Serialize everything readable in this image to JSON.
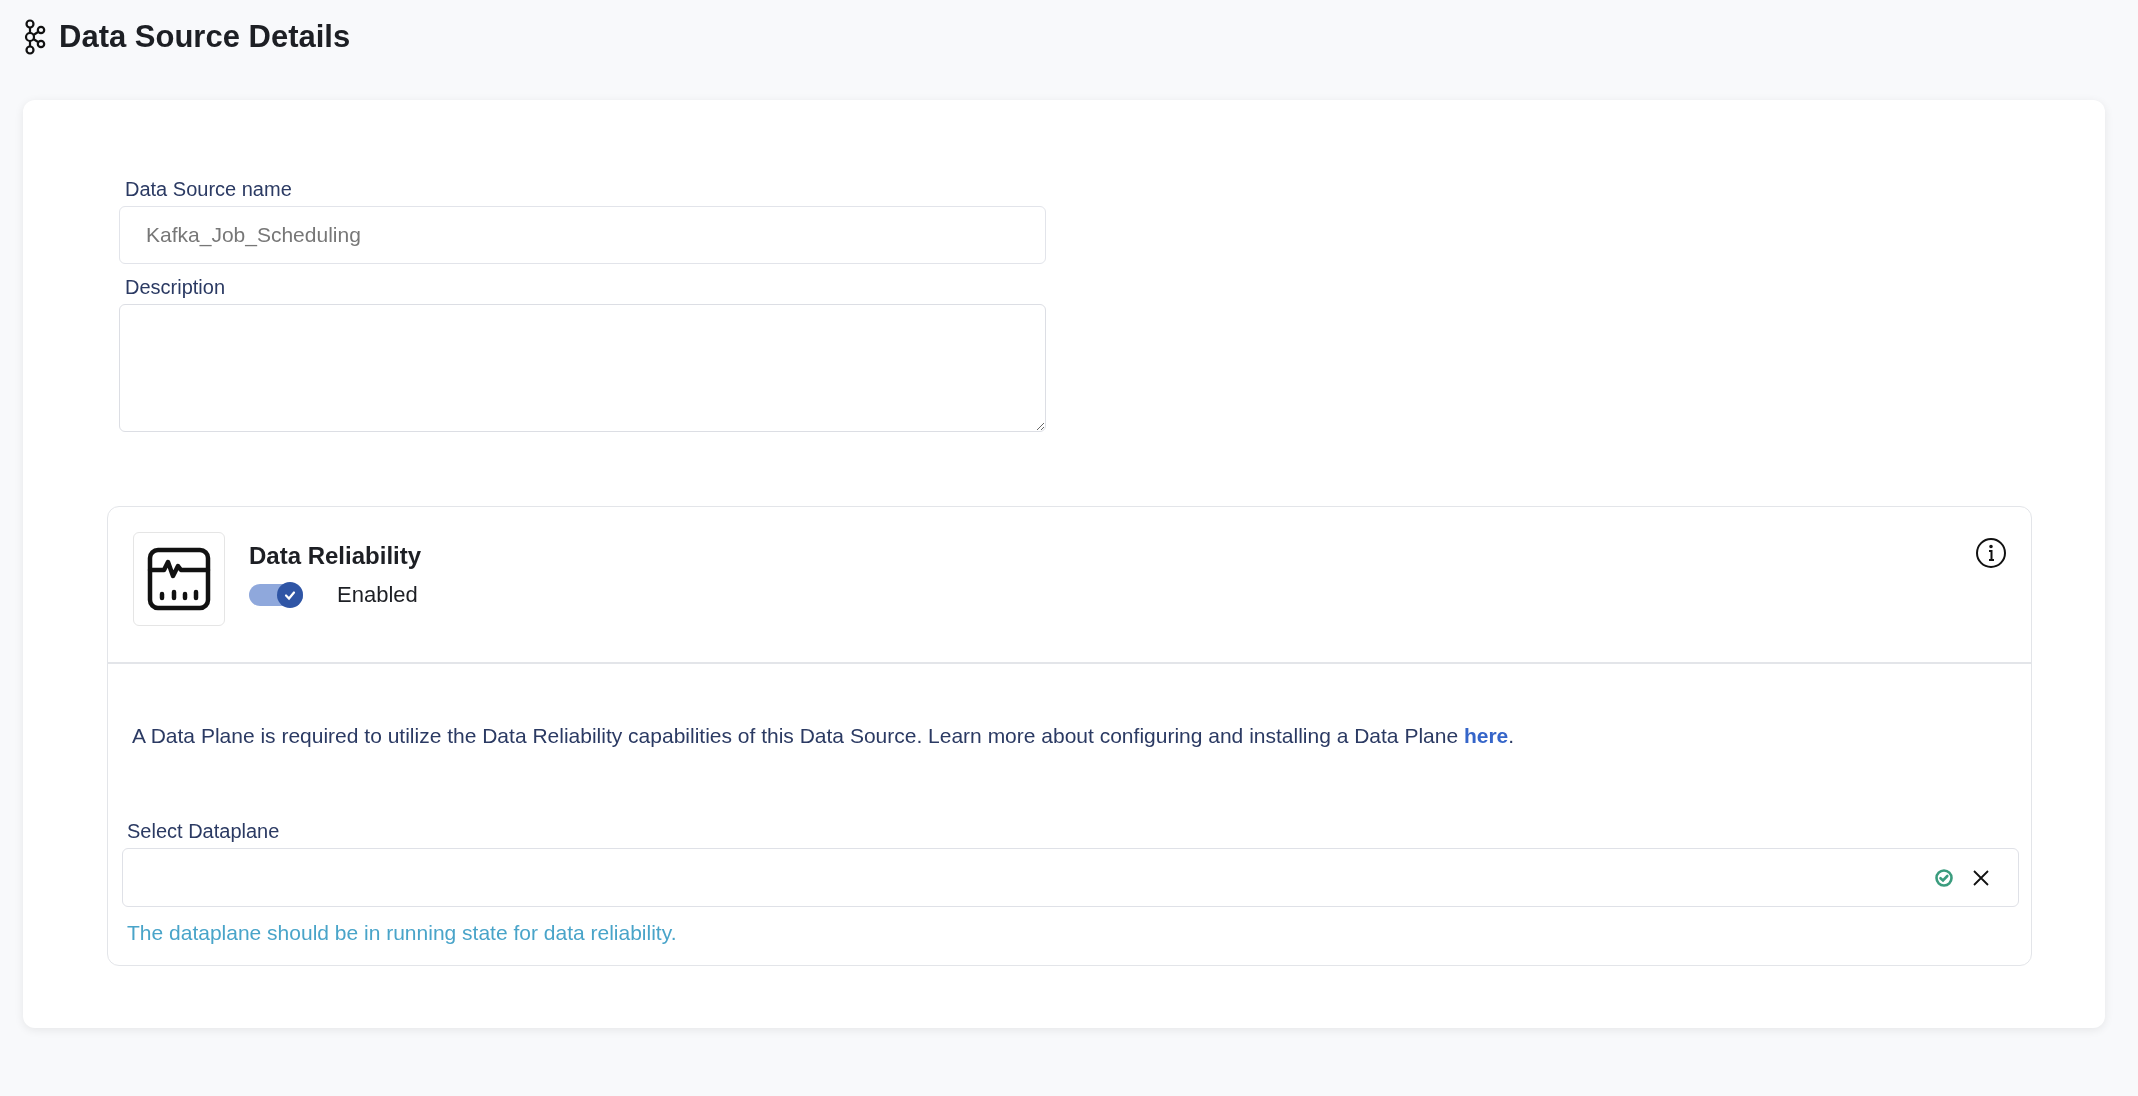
{
  "page": {
    "title": "Data Source Details"
  },
  "form": {
    "name_label": "Data Source name",
    "name_value": "Kafka_Job_Scheduling",
    "description_label": "Description"
  },
  "reliability": {
    "title": "Data Reliability",
    "enabled": true,
    "status_label": "Enabled",
    "notice": {
      "text": "A Data Plane is required to utilize the Data Reliability capabilities of this Data Source. Learn more about configuring and installing a Data Plane ",
      "link": "here",
      "after": "."
    },
    "select_label": "Select Dataplane",
    "hint": "The dataplane should be in running state for data reliability."
  }
}
